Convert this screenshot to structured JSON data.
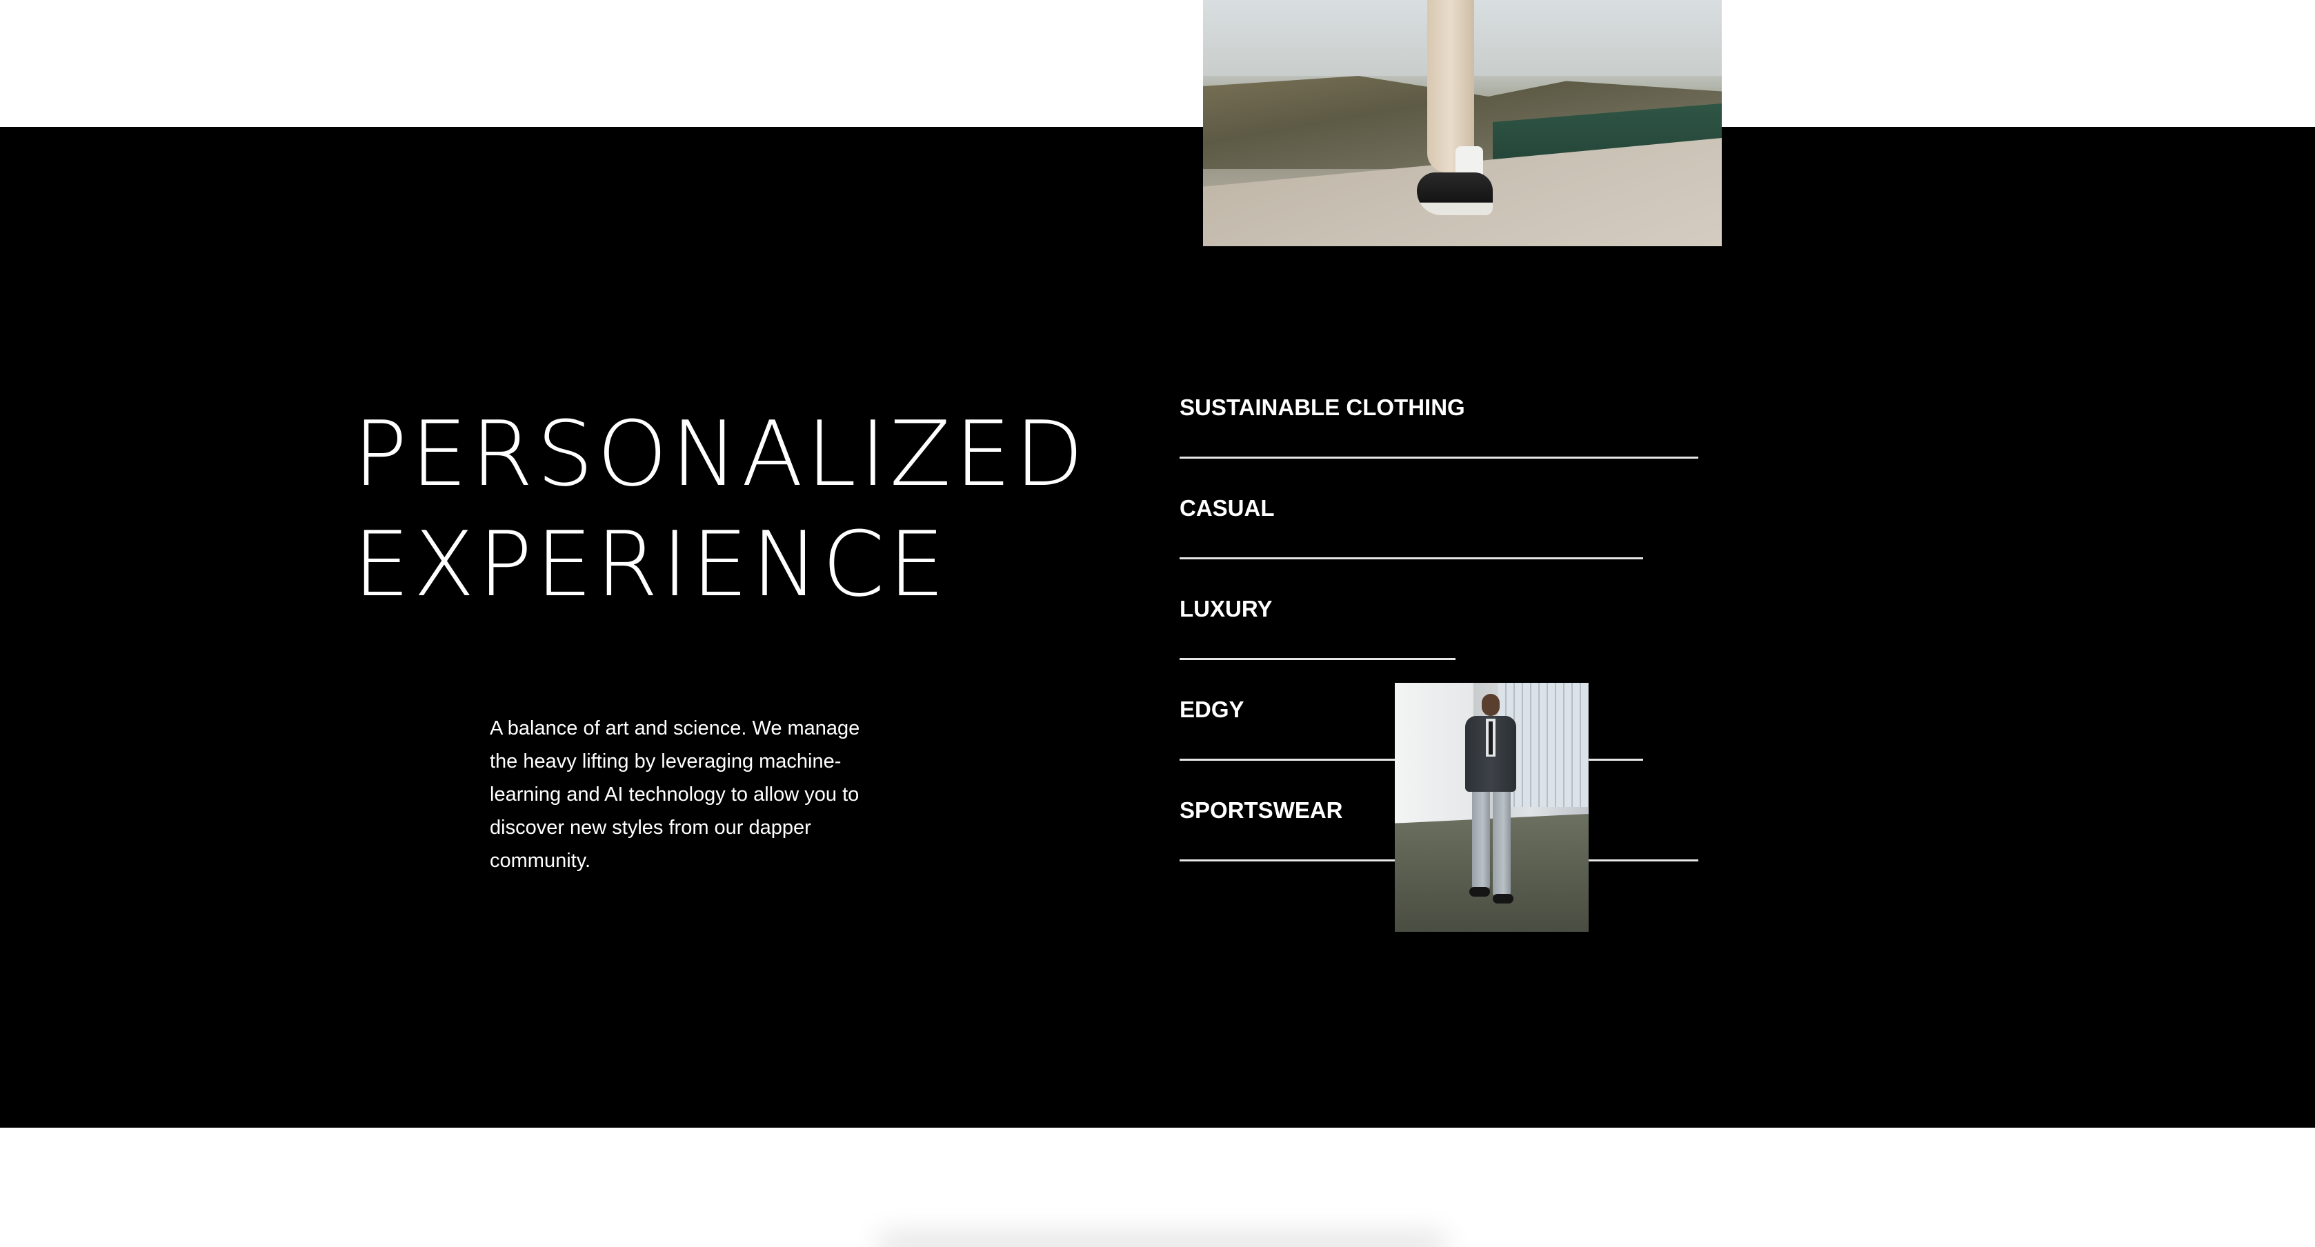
{
  "section": {
    "headline_line1": "PERSONALIZED",
    "headline_line2": "EXPERIENCE",
    "description": "A balance of art and science. We manage the heavy lifting by leveraging machine-learning and AI technology to allow you to discover new styles from our dapper community."
  },
  "styles": [
    {
      "label": "SUSTAINABLE CLOTHING"
    },
    {
      "label": "CASUAL"
    },
    {
      "label": "LUXURY"
    },
    {
      "label": "EDGY"
    },
    {
      "label": "SPORTSWEAR"
    }
  ],
  "colors": {
    "background_dark": "#000000",
    "background_light": "#ffffff",
    "text": "#ffffff",
    "rule": "#e6e6e6"
  },
  "images": {
    "top_photo": "photo-street-sneakers",
    "hover_photo": "photo-man-in-suit"
  }
}
